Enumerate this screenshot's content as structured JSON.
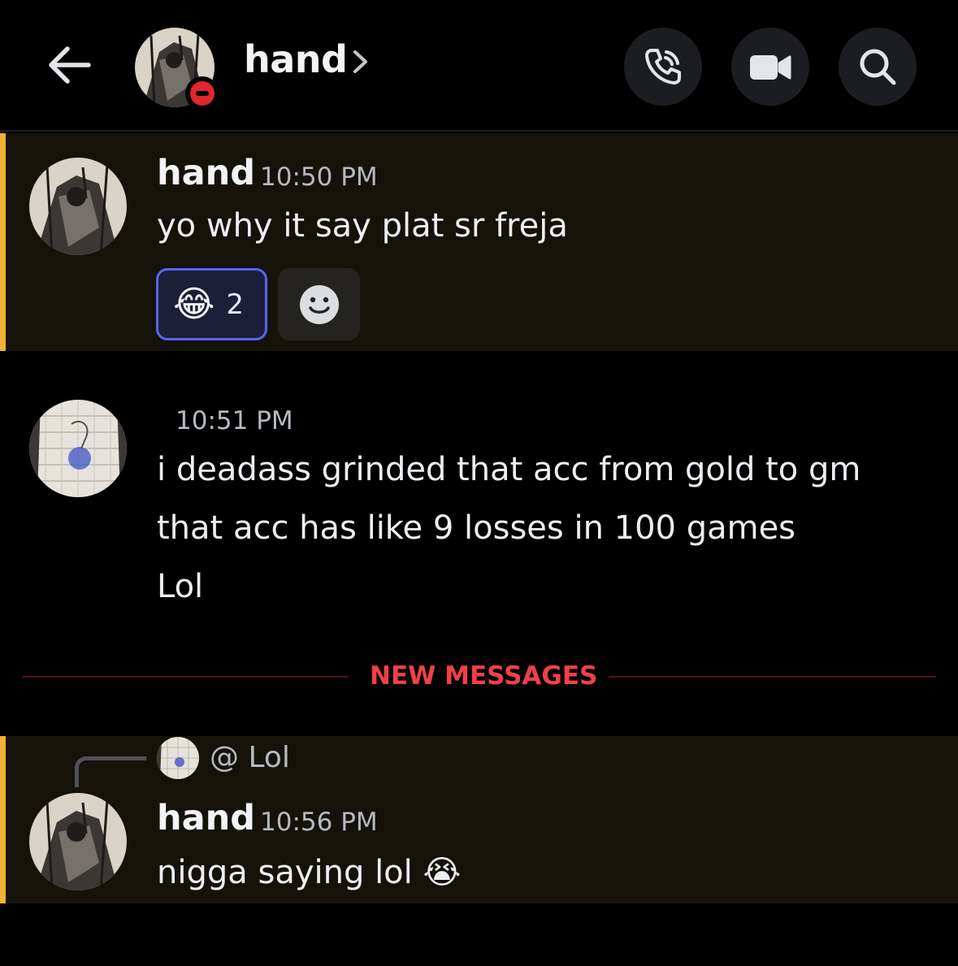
{
  "header": {
    "title": "hand",
    "status": "do-not-disturb",
    "icons": {
      "back": "arrow-left-icon",
      "call": "phone-call-icon",
      "video": "video-camera-icon",
      "search": "search-icon"
    }
  },
  "messages": [
    {
      "author": "hand",
      "time": "10:50 PM",
      "lines": [
        "yo why it say plat sr freja"
      ],
      "reactions": [
        {
          "emoji": "😂",
          "count": "2"
        }
      ],
      "highlighted": true
    },
    {
      "author": "",
      "time": "10:51 PM",
      "lines": [
        "i deadass grinded that acc from gold to gm",
        "that acc has like 9 losses in 100 games",
        "Lol"
      ],
      "highlighted": false
    },
    {
      "reply": {
        "prefix": "@",
        "text": "Lol"
      },
      "author": "hand",
      "time": "10:56 PM",
      "lines": [
        "nigga saying lol 😭"
      ],
      "highlighted": true
    }
  ],
  "divider": {
    "label": "NEW MESSAGES"
  },
  "colors": {
    "background": "#000000",
    "mention_highlight": "#15120a",
    "mention_bar": "#f0b232",
    "new_messages": "#ef4146",
    "reaction_border": "#5865f2",
    "dnd": "#e0262f"
  }
}
